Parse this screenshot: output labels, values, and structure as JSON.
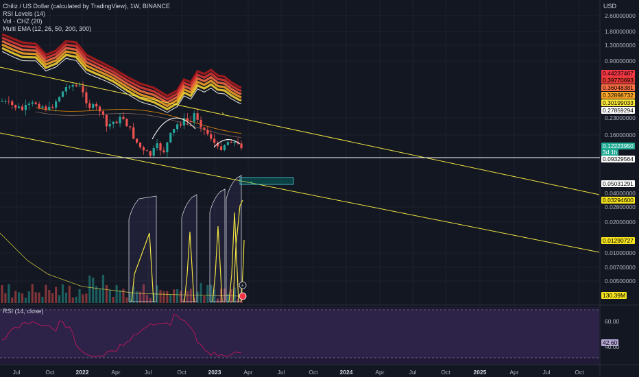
{
  "legend": {
    "title": "Chiliz / US Dollar (calculated by TradingView), 1W, BINANCE",
    "indicators": [
      "RSI Levels (14)",
      "Vol · CHZ (20)",
      "Multi EMA (12, 26, 50, 200, 300)"
    ]
  },
  "axis": {
    "currency": "USD",
    "price_ticks": [
      "2.60000000",
      "1.80000000",
      "1.30000000",
      "0.90000000",
      "0.23000000",
      "0.16000000",
      "0.04000000",
      "0.02800000",
      "0.02000000",
      "0.01000000",
      "0.00700000",
      "0.00500000"
    ],
    "rsi_ticks": [
      "60.00",
      "40.00"
    ],
    "x_ticks": [
      {
        "label": "Jul",
        "year": false
      },
      {
        "label": "Oct",
        "year": false
      },
      {
        "label": "2022",
        "year": true
      },
      {
        "label": "Apr",
        "year": false
      },
      {
        "label": "Jul",
        "year": false
      },
      {
        "label": "Oct",
        "year": false
      },
      {
        "label": "2023",
        "year": true
      },
      {
        "label": "Apr",
        "year": false
      },
      {
        "label": "Jul",
        "year": false
      },
      {
        "label": "Oct",
        "year": false
      },
      {
        "label": "2024",
        "year": true
      },
      {
        "label": "Apr",
        "year": false
      },
      {
        "label": "Jul",
        "year": false
      },
      {
        "label": "Oct",
        "year": false
      },
      {
        "label": "2025",
        "year": true
      },
      {
        "label": "Apr",
        "year": false
      },
      {
        "label": "Jul",
        "year": false
      },
      {
        "label": "Oct",
        "year": false
      }
    ]
  },
  "price_labels": [
    {
      "text": "0.44237467",
      "bg": "#f23645",
      "fg": "#000000"
    },
    {
      "text": "0.39770693",
      "bg": "#e53935",
      "fg": "#000000"
    },
    {
      "text": "0.36048381",
      "bg": "#ff7043",
      "fg": "#000000"
    },
    {
      "text": "0.32898732",
      "bg": "#ffa726",
      "fg": "#000000"
    },
    {
      "text": "0.30199033",
      "bg": "#ffeb3b",
      "fg": "#000000"
    },
    {
      "text": "0.27859294",
      "bg": "#ffffff",
      "fg": "#000000"
    },
    {
      "text": "0.12223950",
      "bg": "#22ab94",
      "fg": "#ffffff"
    },
    {
      "text": "3d 1h",
      "bg": "#22ab94",
      "fg": "#ffffff"
    },
    {
      "text": "0.09329564",
      "bg": "#ffffff",
      "fg": "#000000"
    },
    {
      "text": "0.05031291",
      "bg": "#ffffff",
      "fg": "#000000"
    },
    {
      "text": "0.03294600",
      "bg": "#f7e41e",
      "fg": "#000000"
    },
    {
      "text": "0.01290727",
      "bg": "#f7e41e",
      "fg": "#000000"
    },
    {
      "text": "130.39M",
      "bg": "#f7e41e",
      "fg": "#000000"
    },
    {
      "text": "42.60",
      "bg": "#b4a7d6",
      "fg": "#000000"
    }
  ],
  "rsi": {
    "label": "RSI (14, close)",
    "value": 42.6
  },
  "chart_data": {
    "type": "candlestick",
    "symbol": "CHZ/USD",
    "interval": "1W",
    "scale": "log",
    "ema_periods": [
      12,
      26,
      50,
      200,
      300
    ],
    "ema_last_values": [
      0.44237467,
      0.39770693,
      0.36048381,
      0.32898732,
      0.30199033,
      0.27859294
    ],
    "last_price": 0.1222395,
    "horizontal_level": 0.09329564,
    "trendline_label_value": 0.05031291,
    "trendline_label_value_2": 0.01290727,
    "volume_last": "130.39M",
    "rsi_last": 42.6,
    "colors": {
      "up": "#26a69a",
      "down": "#ef5350",
      "trend": "#f0e442"
    }
  }
}
